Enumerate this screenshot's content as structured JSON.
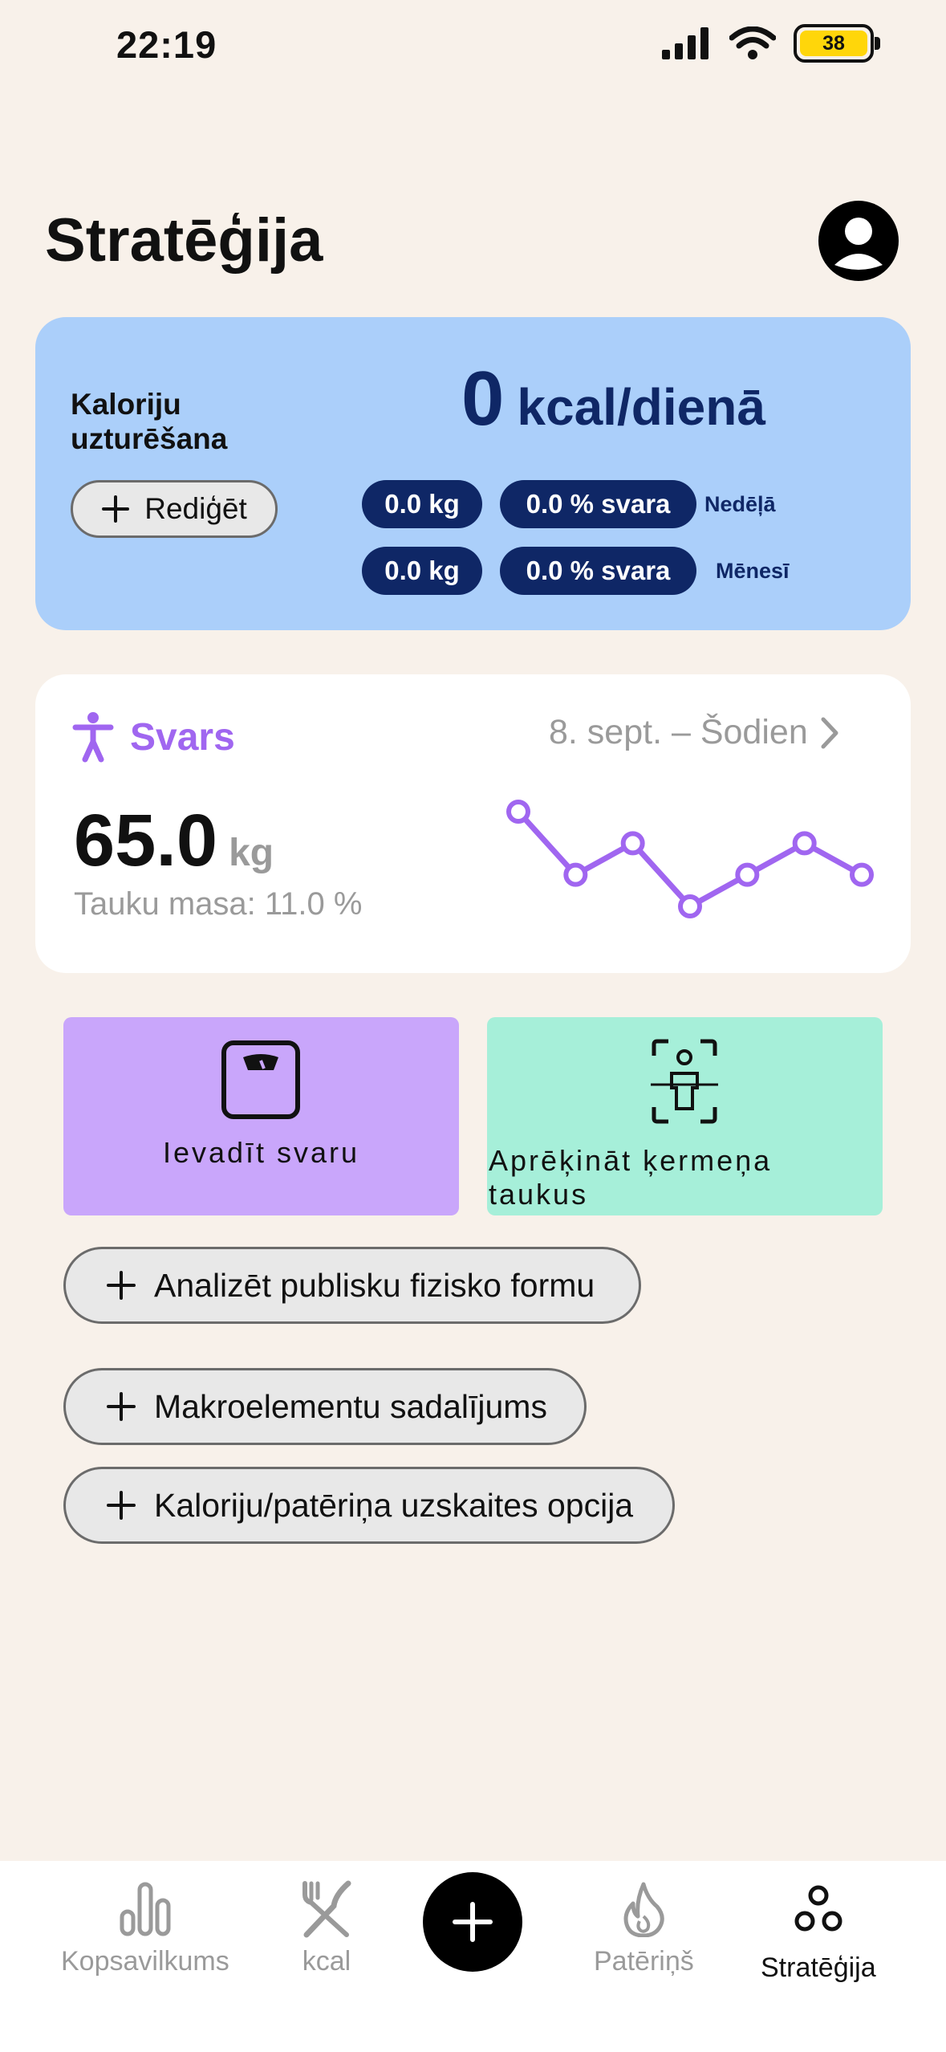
{
  "status_bar": {
    "time": "22:19",
    "battery": "38"
  },
  "page": {
    "title": "Stratēģija"
  },
  "calorie_card": {
    "label": "Kaloriju uzturēšana",
    "edit_label": "Rediģēt",
    "value": "0",
    "unit": "kcal/dienā",
    "weekly": {
      "kg": "0.0 kg",
      "pct": "0.0 % svara",
      "label": "Nedēļā"
    },
    "monthly": {
      "kg": "0.0 kg",
      "pct": "0.0 % svara",
      "label": "Mēnesī"
    }
  },
  "weight_card": {
    "title": "Svars",
    "range": "8. sept. – Šodien",
    "value": "65.0",
    "unit": "kg",
    "fat": "Tauku masa: 11.0 %",
    "accent": "#a066f0",
    "trend_points": [
      4,
      2,
      3,
      1,
      2,
      3,
      2
    ]
  },
  "tiles": {
    "log_weight": "Ievadīt svaru",
    "body_fat": "Aprēķināt ķermeņa taukus"
  },
  "actions": [
    "Analizēt publisku fizisko formu",
    "Makroelementu sadalījums",
    "Kaloriju/patēriņa uzskaites opcija"
  ],
  "tab_bar": {
    "summary": "Kopsavilkums",
    "kcal": "kcal",
    "burn": "Patēriņš",
    "strategy": "Stratēģija"
  }
}
